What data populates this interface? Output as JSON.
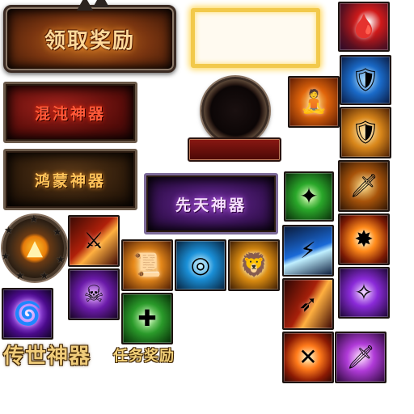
{
  "buttons": {
    "claim_reward": "领取奖励"
  },
  "plates": {
    "chaos_artifact": "混沌神器",
    "hongmeng_artifact": "鸿蒙神器",
    "xiantian_artifact": "先天神器"
  },
  "titles": {
    "legendary_artifact": "传世神器",
    "quest_reward": "任务奖励"
  },
  "icons": [
    {
      "name": "blood-horn-icon",
      "glyph": "🩸"
    },
    {
      "name": "blue-shield-icon",
      "glyph": "🛡"
    },
    {
      "name": "meditation-aura-icon",
      "glyph": "🧘"
    },
    {
      "name": "gold-shield-icon",
      "glyph": "🛡"
    },
    {
      "name": "green-summon-icon",
      "glyph": "✦"
    },
    {
      "name": "golden-blade-icon",
      "glyph": "🗡"
    },
    {
      "name": "flame-slash-icon",
      "glyph": "⚔"
    },
    {
      "name": "fire-burst-icon",
      "glyph": "✸"
    },
    {
      "name": "scroll-talisman-icon",
      "glyph": "📜"
    },
    {
      "name": "blue-vortex-icon",
      "glyph": "◎"
    },
    {
      "name": "golden-lion-icon",
      "glyph": "🦁"
    },
    {
      "name": "ice-slash-icon",
      "glyph": "⚡"
    },
    {
      "name": "purple-claw-icon",
      "glyph": "✧"
    },
    {
      "name": "shadow-warrior-icon",
      "glyph": "☠"
    },
    {
      "name": "purple-vortex-icon",
      "glyph": "🌀"
    },
    {
      "name": "green-cross-icon",
      "glyph": "✚"
    },
    {
      "name": "red-dash-icon",
      "glyph": "➶"
    },
    {
      "name": "fire-cross-icon",
      "glyph": "✕"
    },
    {
      "name": "purple-sword-icon",
      "glyph": "🗡"
    },
    {
      "name": "red-demon-icon",
      "glyph": "👹"
    }
  ],
  "colors": {
    "chaos_text": "#ff5a3a",
    "hongmeng_text": "#ffc35a",
    "xiantian_text": "#f7e0ff",
    "gold_frame": "#f2c94b"
  }
}
